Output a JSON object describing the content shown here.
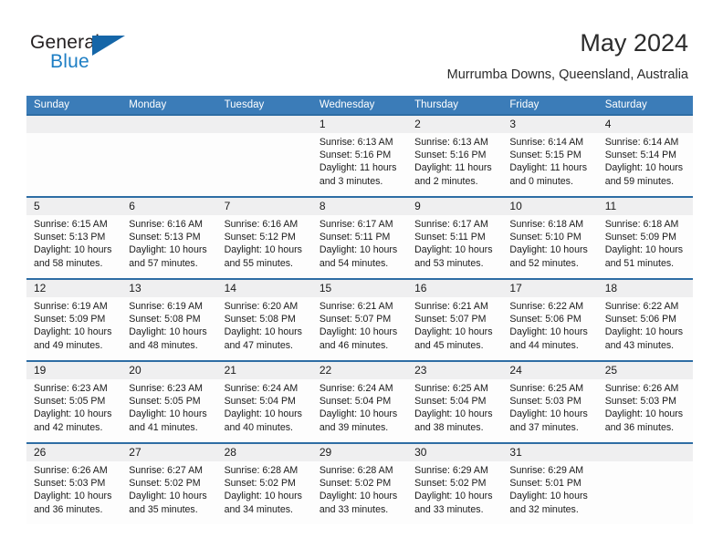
{
  "brand": {
    "name_part1": "General",
    "name_part2": "Blue",
    "color_dark": "#231f20",
    "color_blue": "#1d7ec4",
    "triangle_color": "#1566a8",
    "triangle_icon": "triangle-logo-icon"
  },
  "header": {
    "title": "May 2024",
    "subtitle": "Murrumba Downs, Queensland, Australia"
  },
  "theme": {
    "header_row_bg": "#3b7cb8",
    "week_divider": "#2e6da4",
    "date_band_bg": "#efeff0",
    "cell_bg": "#fdfdfd",
    "text": "#1a1a1a"
  },
  "calendar": {
    "day_headers": [
      "Sunday",
      "Monday",
      "Tuesday",
      "Wednesday",
      "Thursday",
      "Friday",
      "Saturday"
    ],
    "weeks": [
      [
        {
          "day": "",
          "lines": []
        },
        {
          "day": "",
          "lines": []
        },
        {
          "day": "",
          "lines": []
        },
        {
          "day": "1",
          "lines": [
            "Sunrise: 6:13 AM",
            "Sunset: 5:16 PM",
            "Daylight: 11 hours",
            "and 3 minutes."
          ]
        },
        {
          "day": "2",
          "lines": [
            "Sunrise: 6:13 AM",
            "Sunset: 5:16 PM",
            "Daylight: 11 hours",
            "and 2 minutes."
          ]
        },
        {
          "day": "3",
          "lines": [
            "Sunrise: 6:14 AM",
            "Sunset: 5:15 PM",
            "Daylight: 11 hours",
            "and 0 minutes."
          ]
        },
        {
          "day": "4",
          "lines": [
            "Sunrise: 6:14 AM",
            "Sunset: 5:14 PM",
            "Daylight: 10 hours",
            "and 59 minutes."
          ]
        }
      ],
      [
        {
          "day": "5",
          "lines": [
            "Sunrise: 6:15 AM",
            "Sunset: 5:13 PM",
            "Daylight: 10 hours",
            "and 58 minutes."
          ]
        },
        {
          "day": "6",
          "lines": [
            "Sunrise: 6:16 AM",
            "Sunset: 5:13 PM",
            "Daylight: 10 hours",
            "and 57 minutes."
          ]
        },
        {
          "day": "7",
          "lines": [
            "Sunrise: 6:16 AM",
            "Sunset: 5:12 PM",
            "Daylight: 10 hours",
            "and 55 minutes."
          ]
        },
        {
          "day": "8",
          "lines": [
            "Sunrise: 6:17 AM",
            "Sunset: 5:11 PM",
            "Daylight: 10 hours",
            "and 54 minutes."
          ]
        },
        {
          "day": "9",
          "lines": [
            "Sunrise: 6:17 AM",
            "Sunset: 5:11 PM",
            "Daylight: 10 hours",
            "and 53 minutes."
          ]
        },
        {
          "day": "10",
          "lines": [
            "Sunrise: 6:18 AM",
            "Sunset: 5:10 PM",
            "Daylight: 10 hours",
            "and 52 minutes."
          ]
        },
        {
          "day": "11",
          "lines": [
            "Sunrise: 6:18 AM",
            "Sunset: 5:09 PM",
            "Daylight: 10 hours",
            "and 51 minutes."
          ]
        }
      ],
      [
        {
          "day": "12",
          "lines": [
            "Sunrise: 6:19 AM",
            "Sunset: 5:09 PM",
            "Daylight: 10 hours",
            "and 49 minutes."
          ]
        },
        {
          "day": "13",
          "lines": [
            "Sunrise: 6:19 AM",
            "Sunset: 5:08 PM",
            "Daylight: 10 hours",
            "and 48 minutes."
          ]
        },
        {
          "day": "14",
          "lines": [
            "Sunrise: 6:20 AM",
            "Sunset: 5:08 PM",
            "Daylight: 10 hours",
            "and 47 minutes."
          ]
        },
        {
          "day": "15",
          "lines": [
            "Sunrise: 6:21 AM",
            "Sunset: 5:07 PM",
            "Daylight: 10 hours",
            "and 46 minutes."
          ]
        },
        {
          "day": "16",
          "lines": [
            "Sunrise: 6:21 AM",
            "Sunset: 5:07 PM",
            "Daylight: 10 hours",
            "and 45 minutes."
          ]
        },
        {
          "day": "17",
          "lines": [
            "Sunrise: 6:22 AM",
            "Sunset: 5:06 PM",
            "Daylight: 10 hours",
            "and 44 minutes."
          ]
        },
        {
          "day": "18",
          "lines": [
            "Sunrise: 6:22 AM",
            "Sunset: 5:06 PM",
            "Daylight: 10 hours",
            "and 43 minutes."
          ]
        }
      ],
      [
        {
          "day": "19",
          "lines": [
            "Sunrise: 6:23 AM",
            "Sunset: 5:05 PM",
            "Daylight: 10 hours",
            "and 42 minutes."
          ]
        },
        {
          "day": "20",
          "lines": [
            "Sunrise: 6:23 AM",
            "Sunset: 5:05 PM",
            "Daylight: 10 hours",
            "and 41 minutes."
          ]
        },
        {
          "day": "21",
          "lines": [
            "Sunrise: 6:24 AM",
            "Sunset: 5:04 PM",
            "Daylight: 10 hours",
            "and 40 minutes."
          ]
        },
        {
          "day": "22",
          "lines": [
            "Sunrise: 6:24 AM",
            "Sunset: 5:04 PM",
            "Daylight: 10 hours",
            "and 39 minutes."
          ]
        },
        {
          "day": "23",
          "lines": [
            "Sunrise: 6:25 AM",
            "Sunset: 5:04 PM",
            "Daylight: 10 hours",
            "and 38 minutes."
          ]
        },
        {
          "day": "24",
          "lines": [
            "Sunrise: 6:25 AM",
            "Sunset: 5:03 PM",
            "Daylight: 10 hours",
            "and 37 minutes."
          ]
        },
        {
          "day": "25",
          "lines": [
            "Sunrise: 6:26 AM",
            "Sunset: 5:03 PM",
            "Daylight: 10 hours",
            "and 36 minutes."
          ]
        }
      ],
      [
        {
          "day": "26",
          "lines": [
            "Sunrise: 6:26 AM",
            "Sunset: 5:03 PM",
            "Daylight: 10 hours",
            "and 36 minutes."
          ]
        },
        {
          "day": "27",
          "lines": [
            "Sunrise: 6:27 AM",
            "Sunset: 5:02 PM",
            "Daylight: 10 hours",
            "and 35 minutes."
          ]
        },
        {
          "day": "28",
          "lines": [
            "Sunrise: 6:28 AM",
            "Sunset: 5:02 PM",
            "Daylight: 10 hours",
            "and 34 minutes."
          ]
        },
        {
          "day": "29",
          "lines": [
            "Sunrise: 6:28 AM",
            "Sunset: 5:02 PM",
            "Daylight: 10 hours",
            "and 33 minutes."
          ]
        },
        {
          "day": "30",
          "lines": [
            "Sunrise: 6:29 AM",
            "Sunset: 5:02 PM",
            "Daylight: 10 hours",
            "and 33 minutes."
          ]
        },
        {
          "day": "31",
          "lines": [
            "Sunrise: 6:29 AM",
            "Sunset: 5:01 PM",
            "Daylight: 10 hours",
            "and 32 minutes."
          ]
        },
        {
          "day": "",
          "lines": []
        }
      ]
    ]
  }
}
